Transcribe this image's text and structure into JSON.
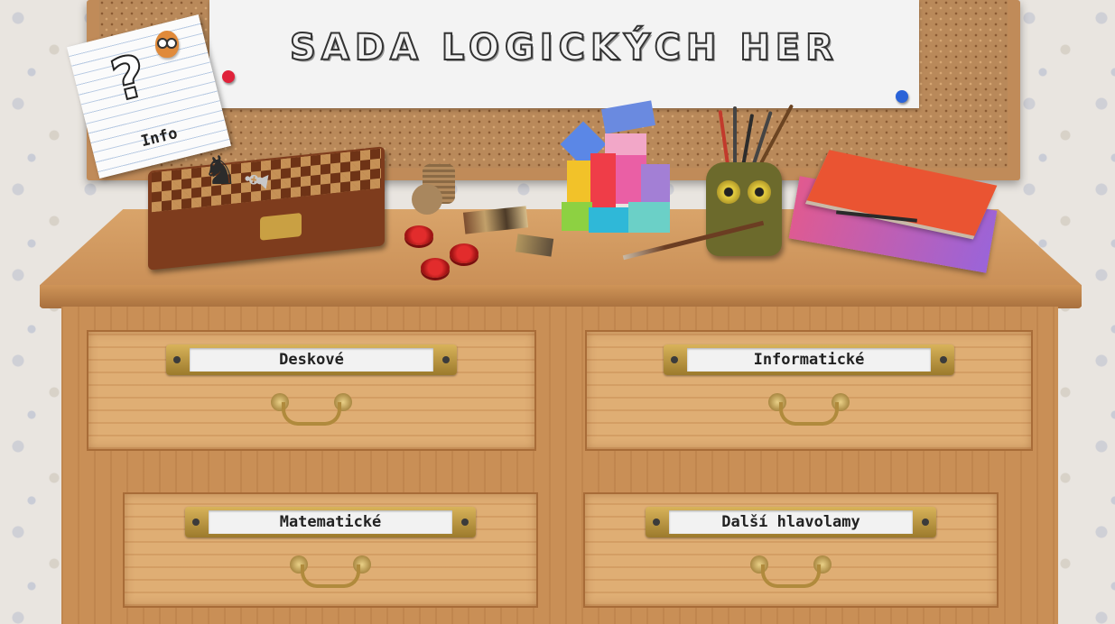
{
  "title": "SADA LOGICKÝCH HER",
  "info": {
    "label": "Info",
    "glyph": "?"
  },
  "drawers": {
    "deskove": "Deskové",
    "informaticke": "Informatické",
    "matematicke": "Matematické",
    "dalsi": "Další hlavolamy"
  },
  "icons": {
    "knight": "♞",
    "fallen_piece": "♝"
  },
  "colors": {
    "wood": "#c98f56",
    "plate_brass": "#c9a043",
    "pin_red": "#e0223a",
    "pin_blue": "#2a63d8"
  }
}
